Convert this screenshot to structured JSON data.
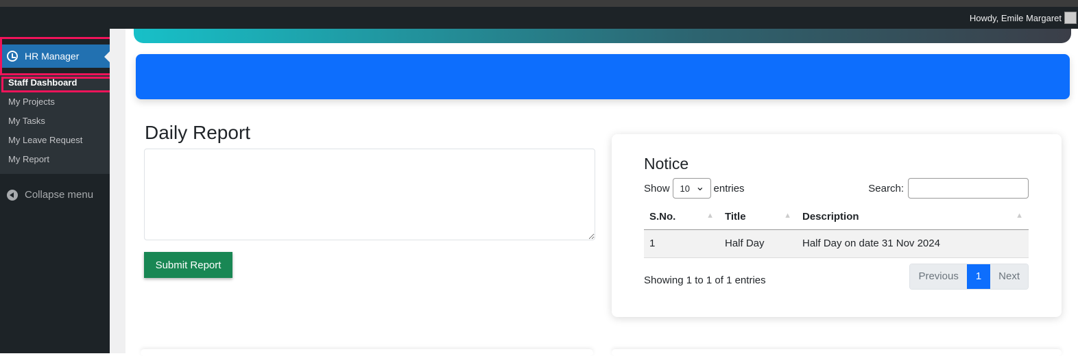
{
  "adminbar": {
    "greeting": "Howdy, Emile Margaret"
  },
  "sidebar": {
    "menu": "HR Manager",
    "items": [
      {
        "label": "Staff Dashboard"
      },
      {
        "label": "My Projects"
      },
      {
        "label": "My Tasks"
      },
      {
        "label": "My Leave Request"
      },
      {
        "label": "My Report"
      }
    ],
    "collapse": "Collapse menu"
  },
  "report": {
    "title": "Daily Report",
    "textarea_value": "",
    "submit": "Submit Report"
  },
  "notice": {
    "title": "Notice",
    "show": "Show",
    "entries_value": "10",
    "entries": "entries",
    "search_label": "Search:",
    "search_value": "",
    "columns": [
      "S.No.",
      "Title",
      "Description"
    ],
    "rows": [
      [
        "1",
        "Half Day",
        "Half Day on date 31 Nov 2024"
      ]
    ],
    "info": "Showing 1 to 1 of 1 entries",
    "pager": {
      "prev": "Previous",
      "page": "1",
      "next": "Next"
    }
  },
  "colors": {
    "accent": "#0d6efd",
    "submit": "#198754",
    "menu_active": "#2271b1",
    "highlight": "#f0145a"
  }
}
